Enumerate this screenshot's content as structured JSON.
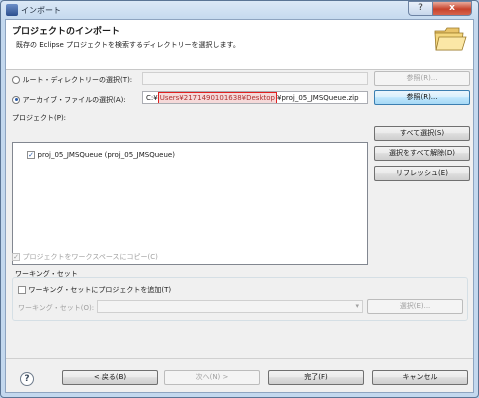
{
  "window": {
    "title": "インポート",
    "help_button_glyph": "?",
    "close_button_glyph": "x"
  },
  "banner": {
    "title": "プロジェクトのインポート",
    "description": "既存の Eclipse プロジェクトを検索するディレクトリーを選択します。"
  },
  "source": {
    "root_dir_label": "ルート・ディレクトリーの選択(T):",
    "root_dir_value": "",
    "root_browse_label": "参照(R)...",
    "archive_label": "アーカイブ・ファイルの選択(A):",
    "archive_value_prefix": "C:¥",
    "archive_value_redacted": "Users¥2171490101638¥Desktop",
    "archive_value_suffix": "¥proj_05_JMSQueue.zip",
    "archive_browse_label": "参照(R)...",
    "selected": "archive"
  },
  "projects": {
    "label": "プロジェクト(P):",
    "items": [
      {
        "label": "proj_05_JMSQueue (proj_05_JMSQueue)",
        "checked": true
      }
    ],
    "select_all_label": "すべて選択(S)",
    "deselect_all_label": "選択をすべて解除(D)",
    "refresh_label": "リフレッシュ(E)"
  },
  "options": {
    "copy_into_workspace_label": "プロジェクトをワークスペースにコピー(C)",
    "copy_into_workspace_checked": true
  },
  "working_sets": {
    "group_title": "ワーキング・セット",
    "add_label": "ワーキング・セットにプロジェクトを追加(T)",
    "add_checked": false,
    "sets_label": "ワーキング・セット(O):",
    "sets_value": "",
    "select_label": "選択(E)..."
  },
  "footer": {
    "help_glyph": "?",
    "back_label": "< 戻る(B)",
    "next_label": "次へ(N) >",
    "finish_label": "完了(F)",
    "cancel_label": "キャンセル"
  },
  "check_glyph": "✓"
}
